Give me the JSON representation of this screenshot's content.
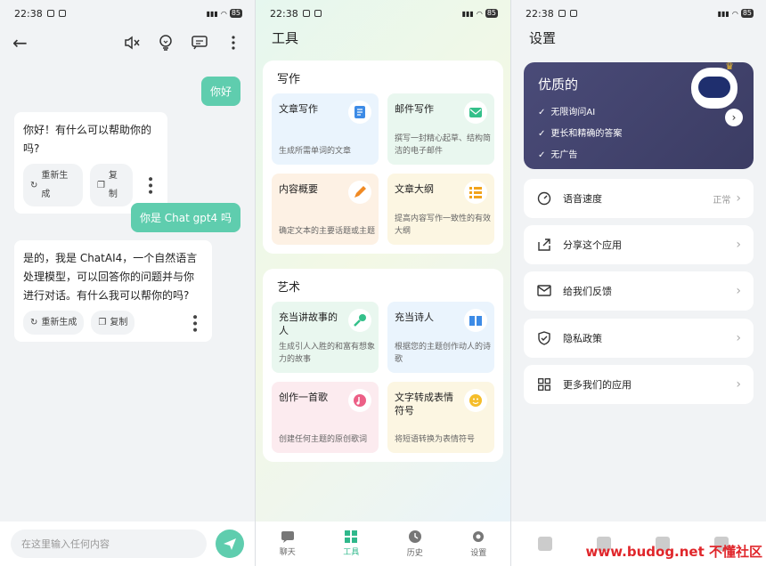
{
  "status": {
    "time": "22:38",
    "battery": "85"
  },
  "chat": {
    "messages": [
      {
        "role": "user",
        "text": "你好"
      },
      {
        "role": "bot",
        "text": "你好！有什么可以帮助你的吗?"
      },
      {
        "role": "user",
        "text": "你是 Chat gpt4 吗"
      },
      {
        "role": "bot",
        "text": "是的，我是 ChatAI4，一个自然语言处理模型，可以回答你的问题并与你进行对话。有什么我可以帮你的吗?"
      }
    ],
    "regen_label": "重新生成",
    "copy_label": "复制",
    "input_placeholder": "在这里输入任何内容"
  },
  "tools": {
    "title": "工具",
    "sections": [
      {
        "heading": "写作",
        "cards": [
          {
            "title": "文章写作",
            "desc": "生成所需单词的文章",
            "icon": "document-icon",
            "color": "blue"
          },
          {
            "title": "邮件写作",
            "desc": "撰写一封精心起草、结构简洁的电子邮件",
            "icon": "mail-icon",
            "color": "green"
          },
          {
            "title": "内容概要",
            "desc": "确定文本的主要话题或主题",
            "icon": "pencil-icon",
            "color": "orange"
          },
          {
            "title": "文章大纲",
            "desc": "提高内容写作一致性的有效大纲",
            "icon": "list-icon",
            "color": "yellow"
          }
        ]
      },
      {
        "heading": "艺术",
        "cards": [
          {
            "title": "充当讲故事的人",
            "desc": "生成引人入胜的和富有想象力的故事",
            "icon": "microphone-icon",
            "color": "green"
          },
          {
            "title": "充当诗人",
            "desc": "根据您的主题创作动人的诗歌",
            "icon": "book-icon",
            "color": "blue"
          },
          {
            "title": "创作一首歌",
            "desc": "创建任何主题的原创歌词",
            "icon": "music-icon",
            "color": "pink"
          },
          {
            "title": "文字转成表情符号",
            "desc": "将短语转换为表情符号",
            "icon": "emoji-icon",
            "color": "yellow"
          }
        ]
      }
    ],
    "tabs": [
      "聊天",
      "工具",
      "历史",
      "设置"
    ]
  },
  "settings": {
    "title": "设置",
    "premium": {
      "title": "优质的",
      "features": [
        "无限询问AI",
        "更长和精确的答案",
        "无广告"
      ]
    },
    "rows": [
      {
        "label": "语音速度",
        "value": "正常",
        "icon": "speed-icon"
      },
      {
        "label": "分享这个应用",
        "value": "",
        "icon": "share-icon"
      },
      {
        "label": "给我们反馈",
        "value": "",
        "icon": "feedback-mail-icon"
      },
      {
        "label": "隐私政策",
        "value": "",
        "icon": "shield-icon"
      },
      {
        "label": "更多我们的应用",
        "value": "",
        "icon": "apps-grid-icon"
      }
    ],
    "watermark": "www.budog.net 不懂社区"
  },
  "colors": {
    "accent": "#5fcdae",
    "premium_bg": "#43446e"
  }
}
